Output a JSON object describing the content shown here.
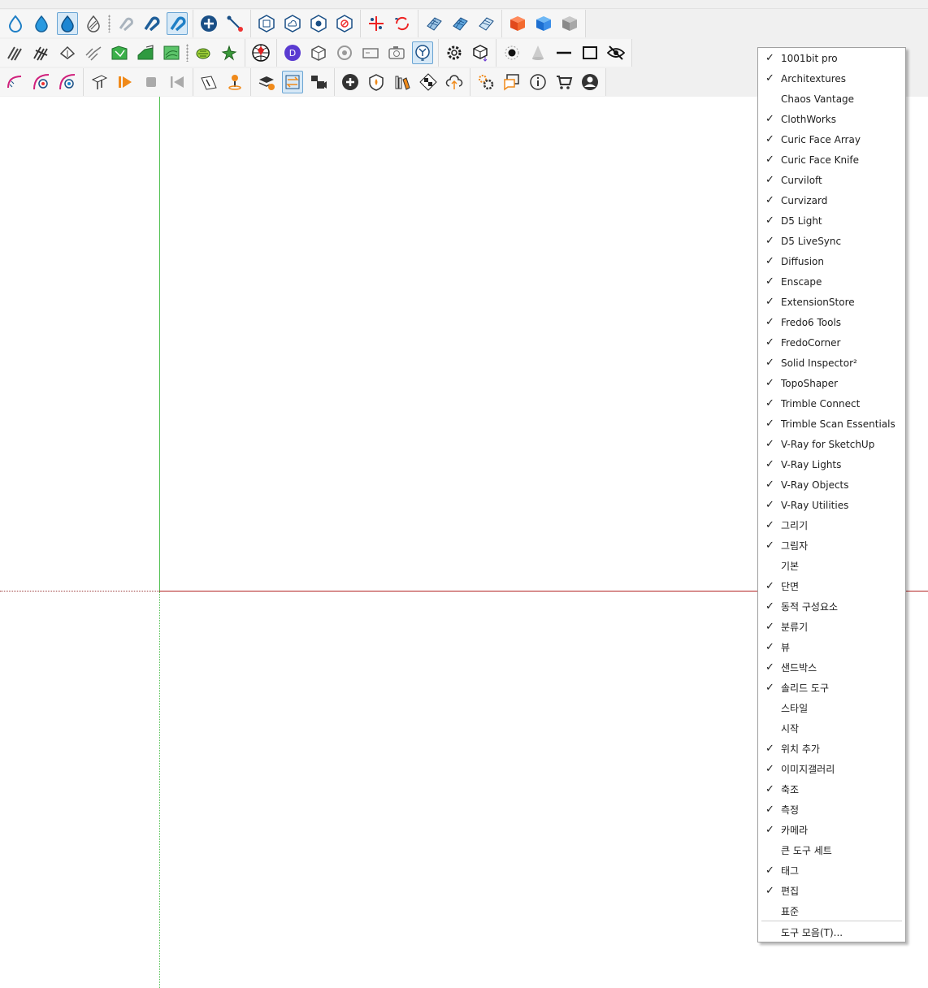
{
  "toolbar_icons": {
    "row1": [
      "water-drop-outline-icon",
      "water-drop-icon",
      "water-drop-filled-icon",
      "water-drop-hatched-icon",
      "magnet-faded-icon",
      "magnet-icon",
      "magnet-active-icon",
      "add-circle-icon",
      "line-node-icon",
      "hexagon-box-icon",
      "hexagon-cloud-icon",
      "hexagon-dot-icon",
      "hexagon-cancel-icon",
      "scatter-arrows-icon",
      "refresh-cloud-icon",
      "mesh-grid-icon",
      "mesh-grid-blue-icon",
      "mesh-grid-light-icon",
      "cube-red-icon",
      "cube-blue-icon",
      "cube-gray-icon"
    ],
    "row2": [
      "hatch-diagonal-icon",
      "hatch-cross-icon",
      "roof-arrows-icon",
      "hatch-light-icon",
      "terrain-green-icon",
      "terrain-slope-icon",
      "contour-icon",
      "spiral-green-icon",
      "leaf-star-icon",
      "globe-sphere-icon",
      "purple-badge-icon",
      "box-3d-icon",
      "orbit-icon",
      "camera-frame-icon",
      "camera-icon",
      "y-axis-dial-icon",
      "gear-outline-icon",
      "box-download-icon",
      "dot-circle-icon",
      "cone-icon",
      "line-icon",
      "square-icon",
      "eye-hidden-icon"
    ],
    "row3": [
      "arc-red-icon",
      "arc-target-icon",
      "arc-target-blue-icon",
      "beam-icon",
      "play-orange-icon",
      "stop-icon",
      "skip-back-icon",
      "slope-person-icon",
      "pin-orange-icon",
      "layers-play-icon",
      "swap-arrows-icon",
      "video-grid-icon",
      "plus-circle-dark-icon",
      "shield-flame-icon",
      "books-icon",
      "checker-icon",
      "cloud-upload-icon",
      "gears-icon",
      "chat-square-icon",
      "info-icon",
      "cart-icon",
      "user-circle-icon"
    ]
  },
  "menu": {
    "check_mark": "✓",
    "items": [
      {
        "label": "1001bit pro",
        "checked": true
      },
      {
        "label": "Architextures",
        "checked": true
      },
      {
        "label": "Chaos Vantage",
        "checked": false
      },
      {
        "label": "ClothWorks",
        "checked": true
      },
      {
        "label": "Curic Face Array",
        "checked": true
      },
      {
        "label": "Curic Face Knife",
        "checked": true
      },
      {
        "label": "Curviloft",
        "checked": true
      },
      {
        "label": "Curvizard",
        "checked": true
      },
      {
        "label": "D5 Light",
        "checked": true
      },
      {
        "label": "D5 LiveSync",
        "checked": true
      },
      {
        "label": "Diffusion",
        "checked": true
      },
      {
        "label": "Enscape",
        "checked": true
      },
      {
        "label": "ExtensionStore",
        "checked": true
      },
      {
        "label": "Fredo6 Tools",
        "checked": true
      },
      {
        "label": "FredoCorner",
        "checked": true
      },
      {
        "label": "Solid Inspector²",
        "checked": true
      },
      {
        "label": "TopoShaper",
        "checked": true
      },
      {
        "label": "Trimble Connect",
        "checked": true
      },
      {
        "label": "Trimble Scan Essentials",
        "checked": true
      },
      {
        "label": "V-Ray for SketchUp",
        "checked": true
      },
      {
        "label": "V-Ray Lights",
        "checked": true
      },
      {
        "label": "V-Ray Objects",
        "checked": true
      },
      {
        "label": "V-Ray Utilities",
        "checked": true
      },
      {
        "label": "그리기",
        "checked": true
      },
      {
        "label": "그림자",
        "checked": true
      },
      {
        "label": "기본",
        "checked": false
      },
      {
        "label": "단면",
        "checked": true
      },
      {
        "label": "동적 구성요소",
        "checked": true
      },
      {
        "label": "분류기",
        "checked": true
      },
      {
        "label": "뷰",
        "checked": true
      },
      {
        "label": "샌드박스",
        "checked": true
      },
      {
        "label": "솔리드 도구",
        "checked": true
      },
      {
        "label": "스타일",
        "checked": false
      },
      {
        "label": "시작",
        "checked": false
      },
      {
        "label": "위치 추가",
        "checked": true
      },
      {
        "label": "이미지갤러리",
        "checked": true
      },
      {
        "label": "축조",
        "checked": true
      },
      {
        "label": "측정",
        "checked": true
      },
      {
        "label": "카메라",
        "checked": true
      },
      {
        "label": "큰 도구 세트",
        "checked": false
      },
      {
        "label": "태그",
        "checked": true
      },
      {
        "label": "편집",
        "checked": true
      },
      {
        "label": "표준",
        "checked": false
      }
    ],
    "footer_label": "도구 모음(T)..."
  }
}
